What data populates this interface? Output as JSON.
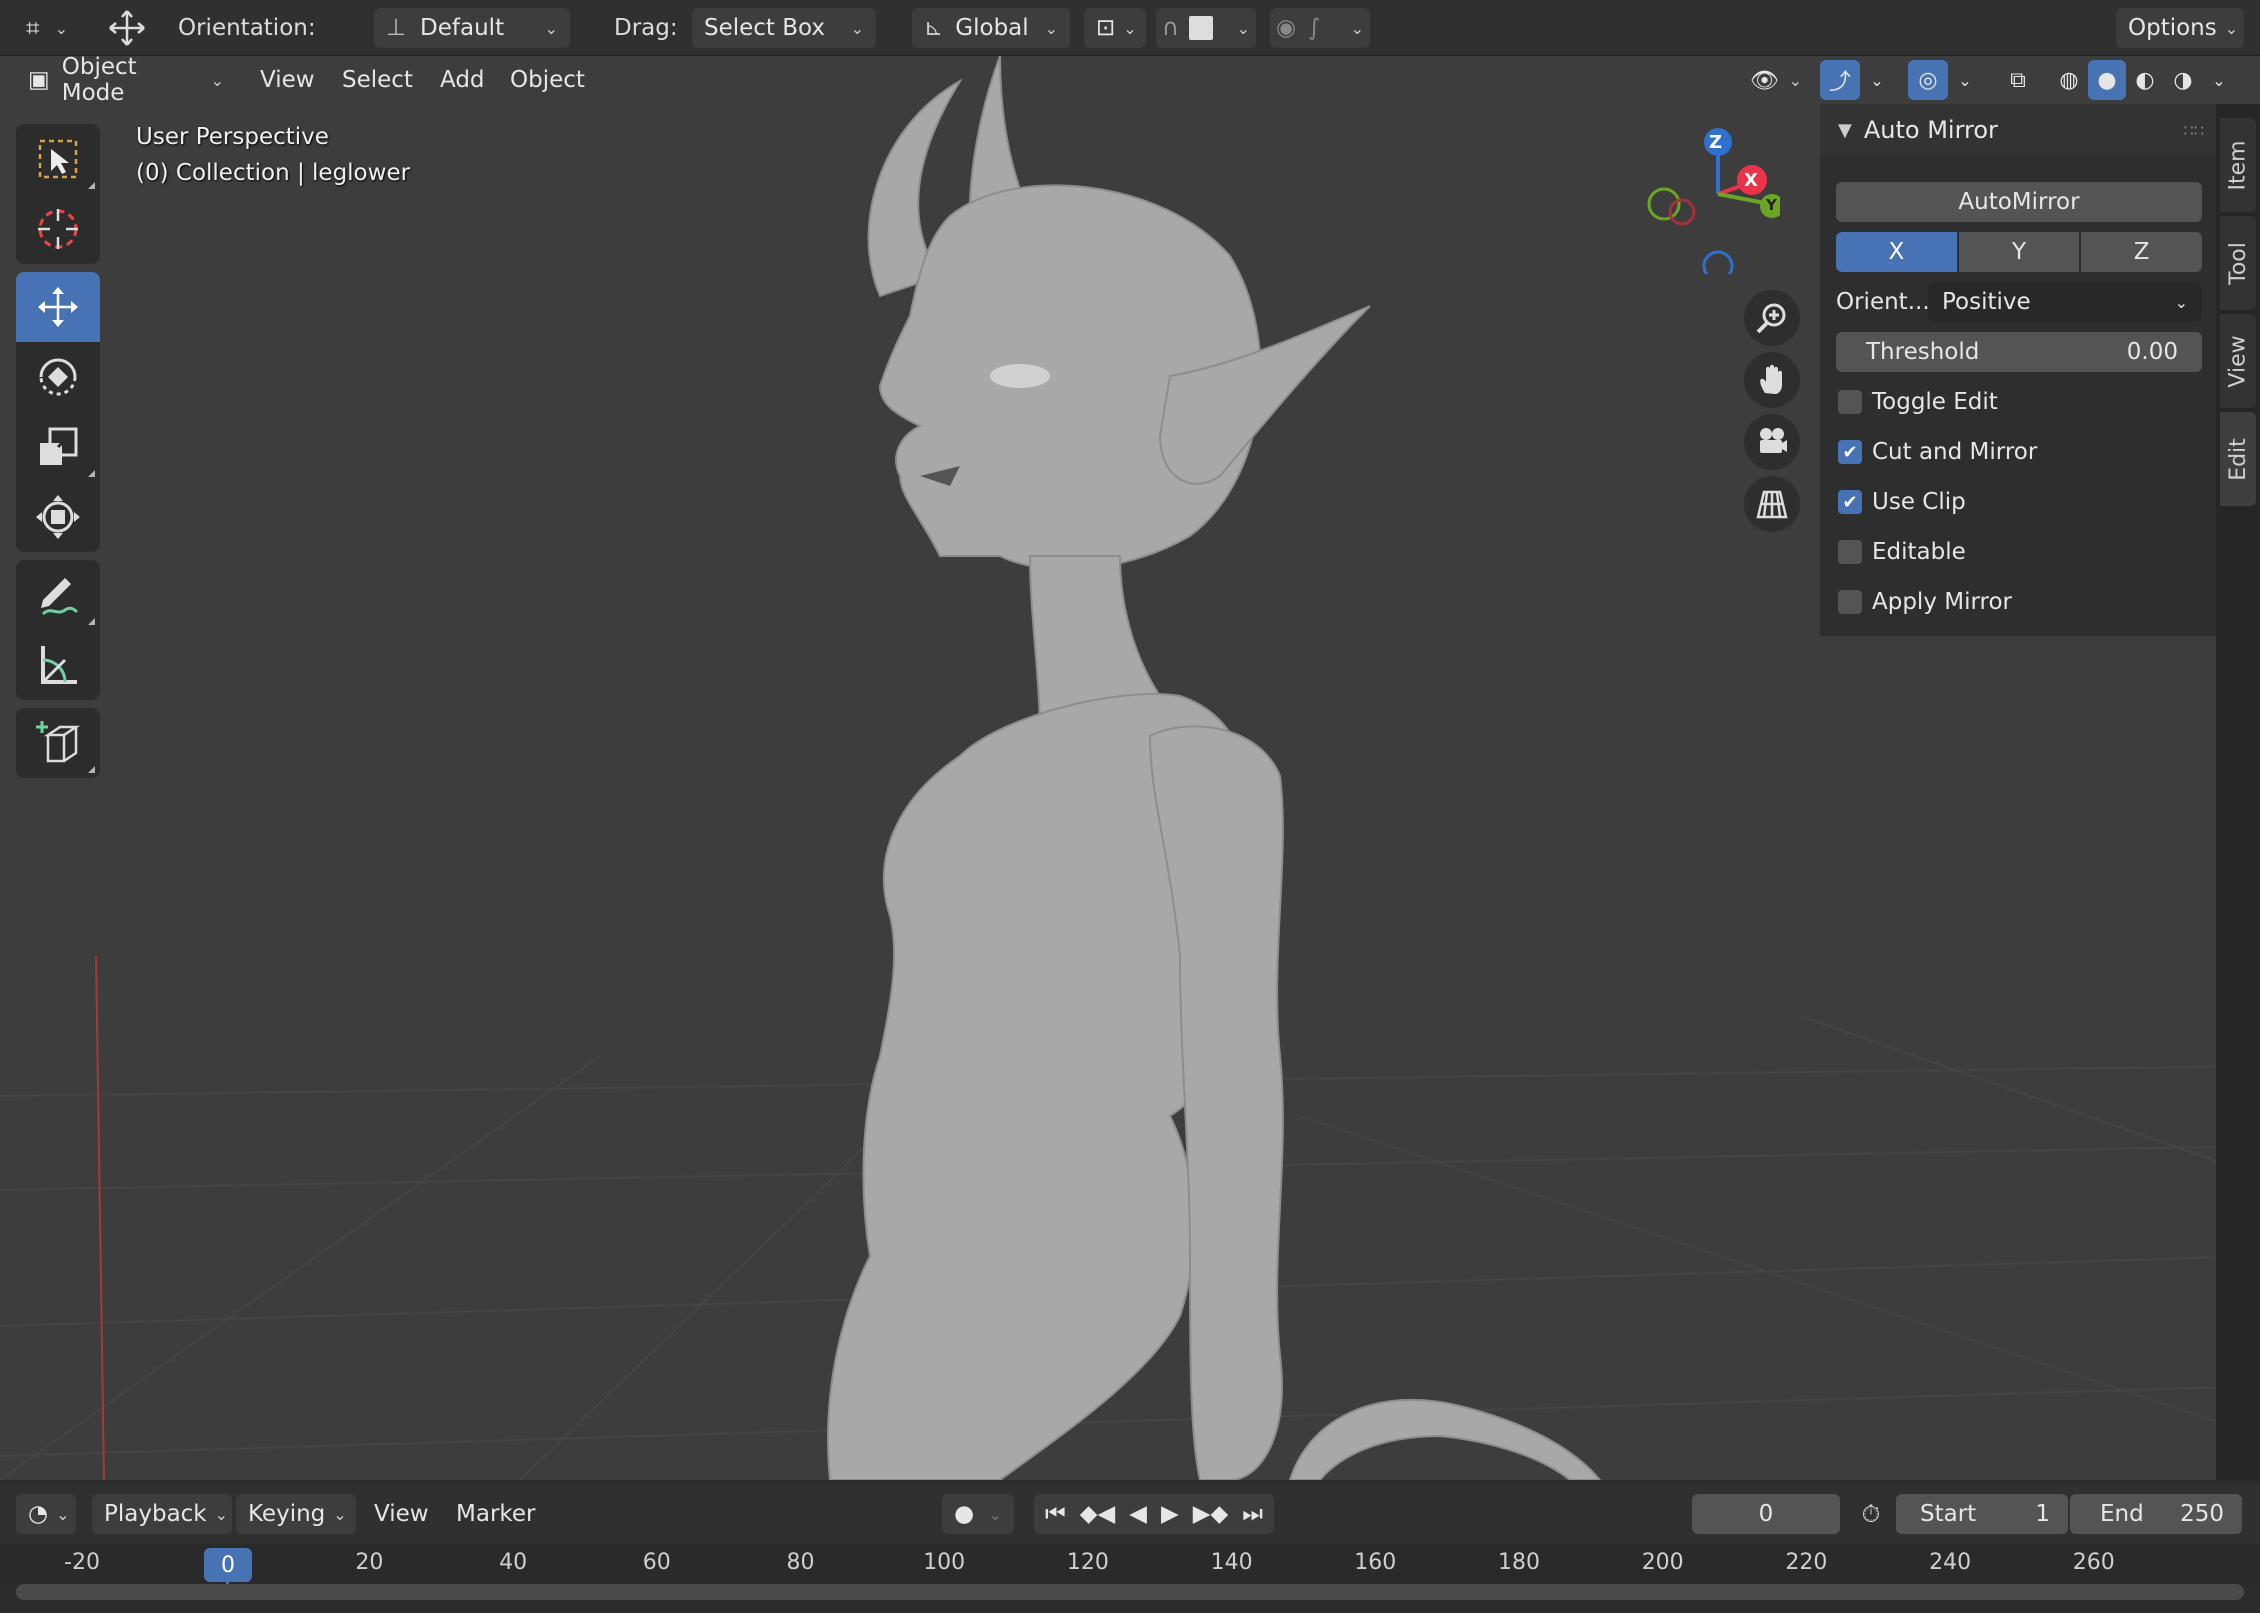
{
  "header": {
    "orientation_label": "Orientation:",
    "orientation_value": "Default",
    "drag_label": "Drag:",
    "drag_value": "Select Box",
    "transform_orientation": "Global",
    "options_label": "Options"
  },
  "viewport_header": {
    "mode": "Object Mode",
    "menus": [
      "View",
      "Select",
      "Add",
      "Object"
    ]
  },
  "viewport": {
    "perspective_label": "User Perspective",
    "collection_label": "(0) Collection | leglower",
    "gizmo_axes": {
      "z": "Z",
      "x": "X",
      "y": "Y"
    }
  },
  "toolbar": {
    "tools": [
      "select-box",
      "cursor",
      "move",
      "rotate",
      "scale",
      "transform",
      "annotate",
      "measure",
      "add-cube"
    ],
    "active": "move"
  },
  "npanel": {
    "panel_title": "Auto Mirror",
    "automirror_button": "AutoMirror",
    "axis_buttons": [
      "X",
      "Y",
      "Z"
    ],
    "orient_label": "Orient...",
    "orient_value": "Positive",
    "threshold_label": "Threshold",
    "threshold_value": "0.00",
    "checkboxes": [
      {
        "label": "Toggle Edit",
        "checked": false
      },
      {
        "label": "Cut and Mirror",
        "checked": true
      },
      {
        "label": "Use Clip",
        "checked": true
      },
      {
        "label": "Editable",
        "checked": false
      },
      {
        "label": "Apply Mirror",
        "checked": false
      }
    ],
    "tabs": [
      "Item",
      "Tool",
      "View",
      "Edit"
    ],
    "active_tab": "Edit"
  },
  "timeline": {
    "menus": {
      "playback": "Playback",
      "keying": "Keying",
      "view": "View",
      "marker": "Marker"
    },
    "current_frame": "0",
    "start_label": "Start",
    "start_value": "1",
    "end_label": "End",
    "end_value": "250",
    "ruler_ticks": [
      "-20",
      "0",
      "20",
      "40",
      "60",
      "80",
      "100",
      "120",
      "140",
      "160",
      "180",
      "200",
      "220",
      "240",
      "260"
    ],
    "playhead": "0"
  },
  "colors": {
    "accent": "#4772b3",
    "axis_x": "#e8334a",
    "axis_y": "#6ba523",
    "axis_z": "#2f6fce"
  }
}
